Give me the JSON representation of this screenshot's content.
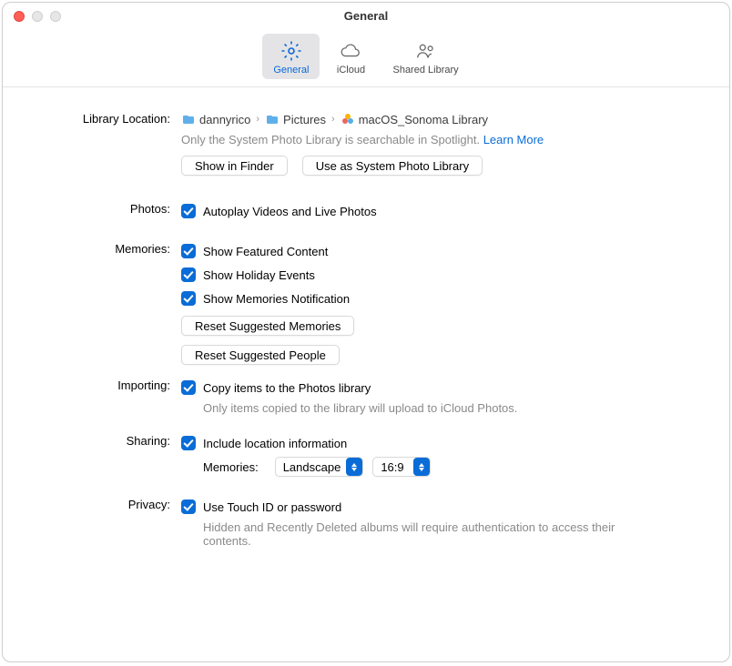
{
  "window": {
    "title": "General"
  },
  "tabs": {
    "general": "General",
    "icloud": "iCloud",
    "shared": "Shared Library"
  },
  "library": {
    "label": "Library Location:",
    "crumb1": "dannyrico",
    "crumb2": "Pictures",
    "crumb3": "macOS_Sonoma Library",
    "note": "Only the System Photo Library is searchable in Spotlight.",
    "learn": "Learn More",
    "show_btn": "Show in Finder",
    "use_btn": "Use as System Photo Library"
  },
  "photos": {
    "label": "Photos:",
    "autoplay": "Autoplay Videos and Live Photos"
  },
  "memories": {
    "label": "Memories:",
    "featured": "Show Featured Content",
    "holiday": "Show Holiday Events",
    "notif": "Show Memories Notification",
    "reset_mem": "Reset Suggested Memories",
    "reset_people": "Reset Suggested People"
  },
  "importing": {
    "label": "Importing:",
    "copy": "Copy items to the Photos library",
    "desc": "Only items copied to the library will upload to iCloud Photos."
  },
  "sharing": {
    "label": "Sharing:",
    "loc": "Include location information",
    "mem_label": "Memories:",
    "orient": "Landscape",
    "aspect": "16:9"
  },
  "privacy": {
    "label": "Privacy:",
    "touch": "Use Touch ID or password",
    "desc": "Hidden and Recently Deleted albums will require authentication to access their contents."
  }
}
